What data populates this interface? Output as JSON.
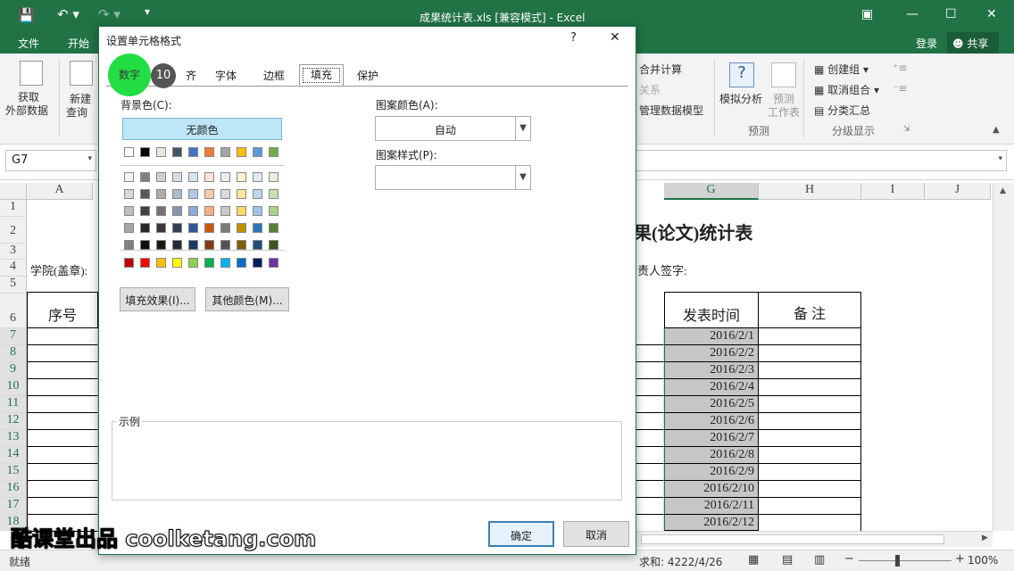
{
  "window": {
    "title": "成果统计表.xls  [兼容模式] - Excel",
    "account": "登录",
    "share": "共享"
  },
  "ribbon_tabs": [
    "文件",
    "开始"
  ],
  "ribbon": {
    "get_data": [
      "获取",
      "外部数据"
    ],
    "new_query": [
      "新建",
      "查询"
    ],
    "consolidate": "合并计算",
    "relations": "关系",
    "data_model": "管理数据模型",
    "whatif": "模拟分析",
    "forecast_sheet": [
      "预测",
      "工作表"
    ],
    "group_label": "预测",
    "create_group": "创建组",
    "ungroup": "取消组合",
    "subtotal": "分类汇总",
    "outline_label": "分级显示"
  },
  "formula_bar": {
    "name_box": "G7"
  },
  "sheet": {
    "columns": [
      "A",
      "G",
      "H",
      "I",
      "J"
    ],
    "rows": [
      "1",
      "2",
      "3",
      "4",
      "5",
      "6",
      "7",
      "8",
      "9",
      "10",
      "11",
      "12",
      "13",
      "14",
      "15",
      "16",
      "17",
      "18"
    ],
    "title_fragment": "果(论文)统计表",
    "row4_left": "学院(盖章):",
    "row4_right": "责人签字:",
    "header_a": "序号",
    "header_g": "发表时间",
    "header_h": "备 注",
    "dates": [
      "2016/2/1",
      "2016/2/2",
      "2016/2/3",
      "2016/2/4",
      "2016/2/5",
      "2016/2/6",
      "2016/2/7",
      "2016/2/8",
      "2016/2/9",
      "2016/2/10",
      "2016/2/11",
      "2016/2/12"
    ]
  },
  "status": {
    "ready": "就绪",
    "sum": "求和: 4222/4/26",
    "zoom": "100%"
  },
  "dialog": {
    "title": "设置单元格格式",
    "help": "?",
    "close": "✕",
    "tabs": [
      "数字",
      "对齐",
      "字体",
      "边框",
      "填充",
      "保护"
    ],
    "tab_number_fragment": "齐",
    "step_badge": "10",
    "bg_color_label": "背景色(C):",
    "no_color": "无颜色",
    "pattern_color_label": "图案颜色(A):",
    "pattern_color_value": "自动",
    "pattern_style_label": "图案样式(P):",
    "fill_effects": "填充效果(I)...",
    "more_colors": "其他颜色(M)...",
    "sample_label": "示例",
    "ok": "确定",
    "cancel": "取消"
  },
  "palette": {
    "row1": [
      "#ffffff",
      "#000000",
      "#e7e6e6",
      "#44546a",
      "#4472c4",
      "#ed7d31",
      "#a5a5a5",
      "#ffc000",
      "#5b9bd5",
      "#70ad47"
    ],
    "tints": [
      [
        "#f2f2f2",
        "#808080",
        "#d0cece",
        "#d6dce4",
        "#dae3f3",
        "#fbe5d6",
        "#ededed",
        "#fff2cc",
        "#deebf7",
        "#e2f0d9"
      ],
      [
        "#d9d9d9",
        "#595959",
        "#aeabab",
        "#adb9ca",
        "#b4c7e7",
        "#f8cbad",
        "#dbdbdb",
        "#ffe699",
        "#bdd7ee",
        "#c5e0b4"
      ],
      [
        "#bfbfbf",
        "#404040",
        "#767171",
        "#8497b0",
        "#8faadc",
        "#f4b183",
        "#c9c9c9",
        "#ffd966",
        "#9dc3e6",
        "#a9d18e"
      ],
      [
        "#a6a6a6",
        "#262626",
        "#3b3838",
        "#333f50",
        "#2f5597",
        "#c55a11",
        "#7b7b7b",
        "#bf9000",
        "#2e75b6",
        "#548235"
      ],
      [
        "#808080",
        "#0d0d0d",
        "#171717",
        "#222a35",
        "#1f3864",
        "#843c0c",
        "#525252",
        "#7f6000",
        "#1f4e79",
        "#385723"
      ]
    ],
    "standard": [
      "#c00000",
      "#ff0000",
      "#ffc000",
      "#ffff00",
      "#92d050",
      "#00b050",
      "#00b0f0",
      "#0070c0",
      "#002060",
      "#7030a0"
    ]
  },
  "watermark": "酷课堂出品 coolketang.com",
  "colors": {
    "excel_green": "#217346",
    "highlight_circle": "#22dd44",
    "no_color_button": "#bde6f7"
  }
}
